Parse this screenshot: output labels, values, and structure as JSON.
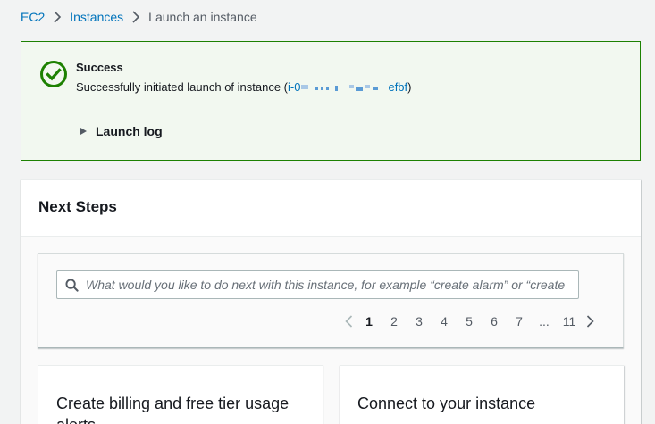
{
  "breadcrumb": {
    "items": [
      {
        "label": "EC2",
        "link": true
      },
      {
        "label": "Instances",
        "link": true
      },
      {
        "label": "Launch an instance",
        "link": false
      }
    ]
  },
  "alert": {
    "title": "Success",
    "message_prefix": "Successfully initiated launch of instance (",
    "instance_id_start": "i-0",
    "instance_id_end": "efbf",
    "message_suffix": ")",
    "launch_log_label": "Launch log",
    "status_color": "#1d8102"
  },
  "next_steps": {
    "title": "Next Steps",
    "search_placeholder": "What would you like to do next with this instance, for example “create alarm” or “create",
    "pagination": {
      "pages": [
        "1",
        "2",
        "3",
        "4",
        "5",
        "6",
        "7",
        "...",
        "11"
      ],
      "current": "1"
    },
    "cards": [
      {
        "title": "Create billing and free tier usage alerts"
      },
      {
        "title": "Connect to your instance"
      }
    ]
  },
  "colors": {
    "link": "#0073bb",
    "success": "#1d8102",
    "text": "#16191f"
  }
}
